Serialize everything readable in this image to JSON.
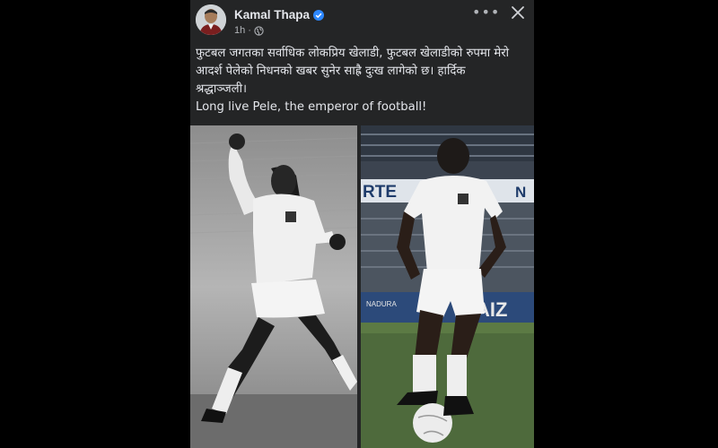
{
  "post": {
    "author": "Kamal Thapa",
    "time": "1h",
    "meta_separator": "·",
    "caption_lines": [
      "फुटबल जगतका सर्वाधिक लोकप्रिय खेलाडी, फुटबल खेलाडीको रुपमा मेरो",
      "आदर्श पेलेको निधनको खबर सुनेर साह्रै दुःख लागेको छ। हार्दिक",
      "श्रद्धाञ्जली।",
      "Long live Pele, the emperor of football!"
    ],
    "more_label": "•••",
    "right_photo_banner_left": "RTE",
    "right_photo_banner_right": "N",
    "right_photo_sign": "AIZ",
    "right_photo_sign_small": "NADURA"
  },
  "icons": {
    "verified": "verified-badge-icon",
    "audience": "globe-icon",
    "more": "more-options-icon",
    "close": "close-icon"
  },
  "colors": {
    "background": "#000000",
    "card": "#242526",
    "text": "#e4e6eb",
    "secondary_text": "#b0b3b8",
    "verified": "#2d88ff"
  }
}
